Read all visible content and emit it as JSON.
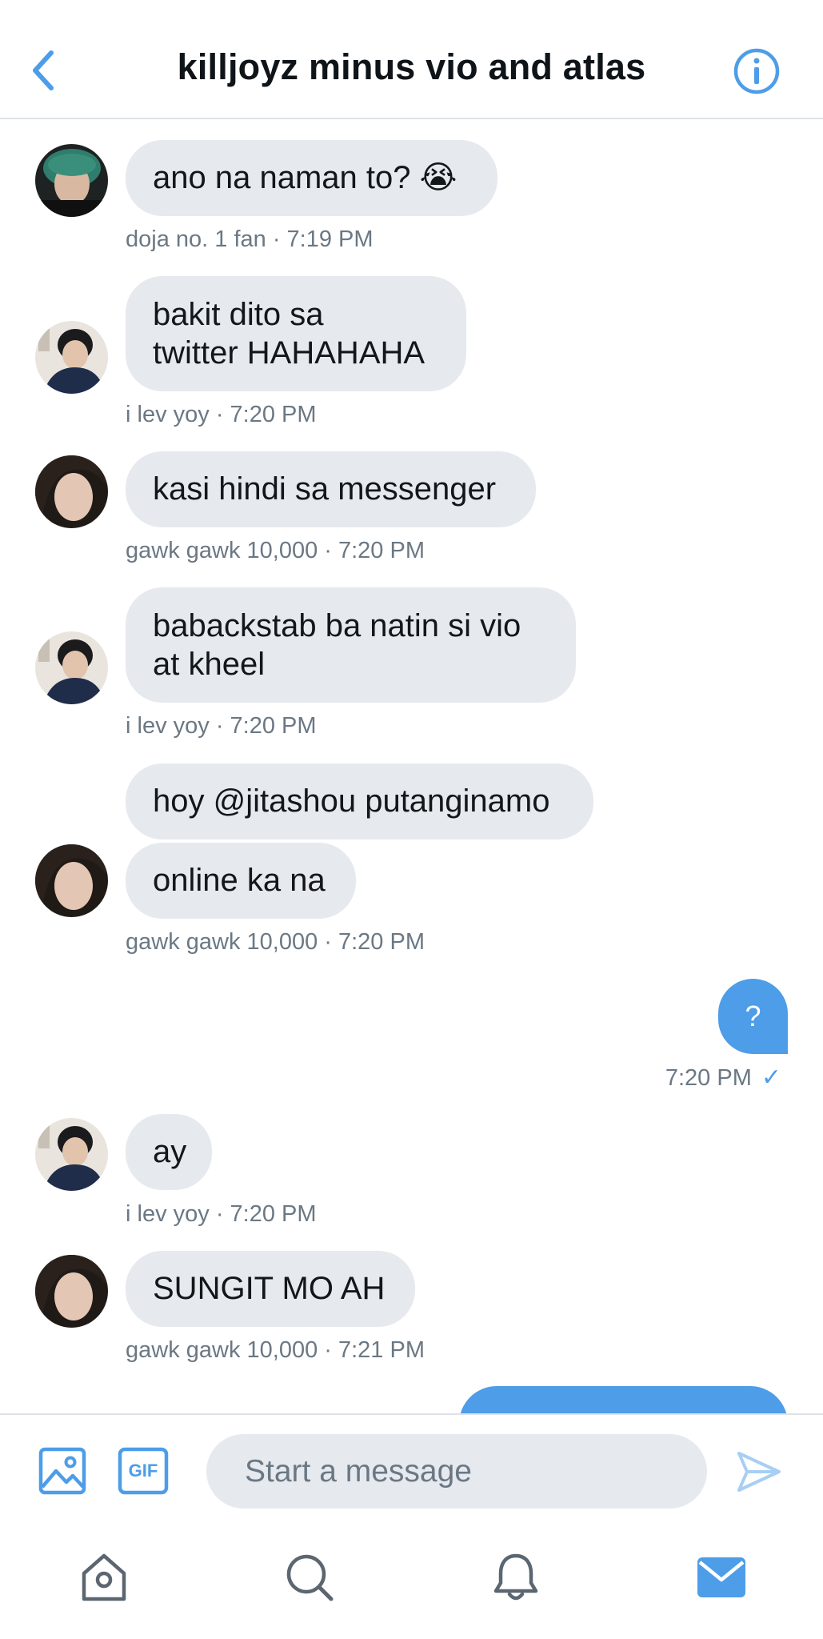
{
  "header": {
    "title": "killjoyz minus vio and atlas",
    "back_icon": "chevron-left-icon",
    "info_icon": "info-icon"
  },
  "colors": {
    "accent": "#4d9de8",
    "incoming_bubble": "#e6e9ee",
    "meta_text": "#6b7884"
  },
  "messages": [
    {
      "text_line1": "ano na naman to?",
      "emoji": "😭",
      "meta": "doja no. 1 fan · 7:19 PM"
    },
    {
      "text_line1": "bakit dito sa",
      "text_line2": "twitter HAHAHAHA",
      "meta": "i lev yoy · 7:20 PM"
    },
    {
      "text_line1": "kasi hindi sa messenger",
      "meta": "gawk gawk 10,000 · 7:20 PM"
    },
    {
      "text_line1": "babackstab ba natin si vio",
      "text_line2": "at kheel",
      "meta": "i lev yoy · 7:20 PM"
    },
    {
      "text_line1": "hoy @jitashou putanginamo",
      "text_line2": "online ka na",
      "meta": "gawk gawk 10,000 · 7:20 PM"
    },
    {
      "outgoing": true,
      "text_line1": "?",
      "meta": "7:20 PM",
      "status": "✓"
    },
    {
      "text_line1": "ay",
      "meta": "i lev yoy · 7:20 PM"
    },
    {
      "text_line1": "SUNGIT MO AH",
      "meta": "gawk gawk 10,000 · 7:21 PM"
    }
  ],
  "composer": {
    "placeholder": "Start a message",
    "gif_label": "GIF",
    "media_icon": "image-icon",
    "send_icon": "send-icon"
  },
  "tabbar": [
    "home-icon",
    "search-icon",
    "notifications-icon",
    "messages-icon"
  ]
}
